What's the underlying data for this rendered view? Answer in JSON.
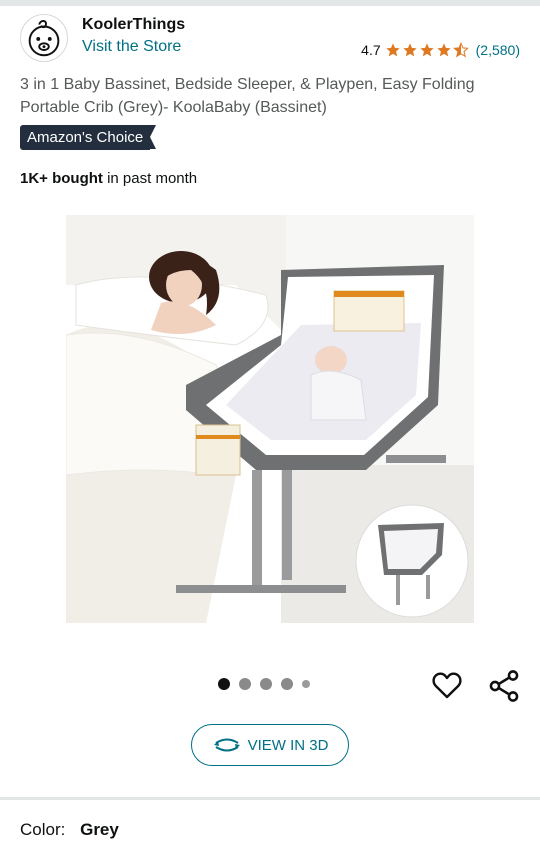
{
  "store": {
    "name": "KoolerThings",
    "visit_link": "Visit the Store",
    "rating_value": "4.7",
    "rating_count": "(2,580)",
    "stars_filled": 4.5
  },
  "product": {
    "title": "3 in 1 Baby Bassinet, Bedside Sleeper, & Playpen, Easy Folding Portable Crib (Grey)- KoolaBaby (Bassinet)",
    "badge": "Amazon's Choice",
    "bought_bold": "1K+ bought",
    "bought_rest": " in past month"
  },
  "gallery": {
    "image_count": 5,
    "active_index": 0,
    "view_3d_label": "VIEW IN 3D"
  },
  "variant": {
    "color_label": "Color:",
    "color_value": "Grey"
  },
  "colors": {
    "link": "#007185",
    "star": "#de7921",
    "badge_bg": "#232f3e",
    "text": "#0f1111",
    "secondary_text": "#565959"
  }
}
